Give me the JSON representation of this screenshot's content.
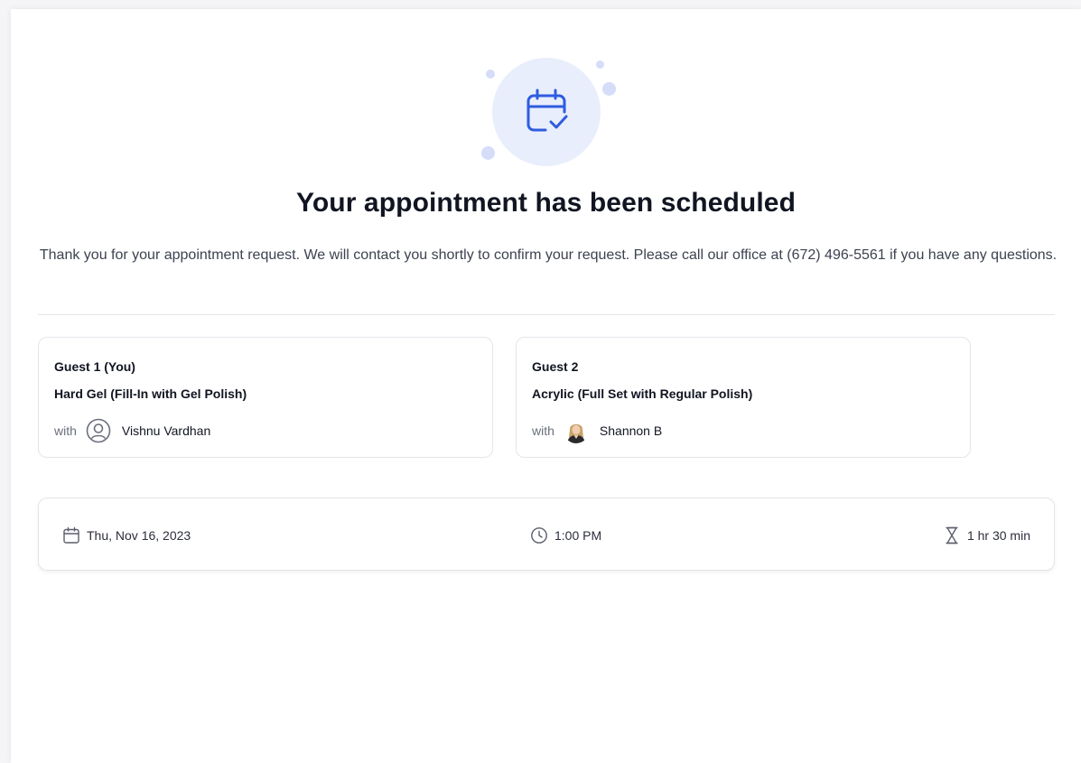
{
  "confirmation": {
    "title": "Your appointment has been scheduled",
    "message": "Thank you for your appointment request. We will contact you shortly to confirm your request. Please call our office at (672) 496-5561 if you have any questions.",
    "hero_icon": "calendar-check-icon",
    "accent_color": "#2f5ce0"
  },
  "guests": [
    {
      "title": "Guest 1 (You)",
      "service": "Hard Gel (Fill-In with Gel Polish)",
      "with_label": "with",
      "staff_name": "Vishnu Vardhan",
      "avatar_icon": "user-circle-icon"
    },
    {
      "title": "Guest 2",
      "service": "Acrylic (Full Set with Regular Polish)",
      "with_label": "with",
      "staff_name": "Shannon B",
      "avatar_icon": "staff-photo-avatar"
    }
  ],
  "summary": {
    "date": "Thu, Nov 16, 2023",
    "date_icon": "calendar-icon",
    "time": "1:00 PM",
    "time_icon": "clock-icon",
    "duration": "1 hr 30 min",
    "duration_icon": "hourglass-icon"
  }
}
